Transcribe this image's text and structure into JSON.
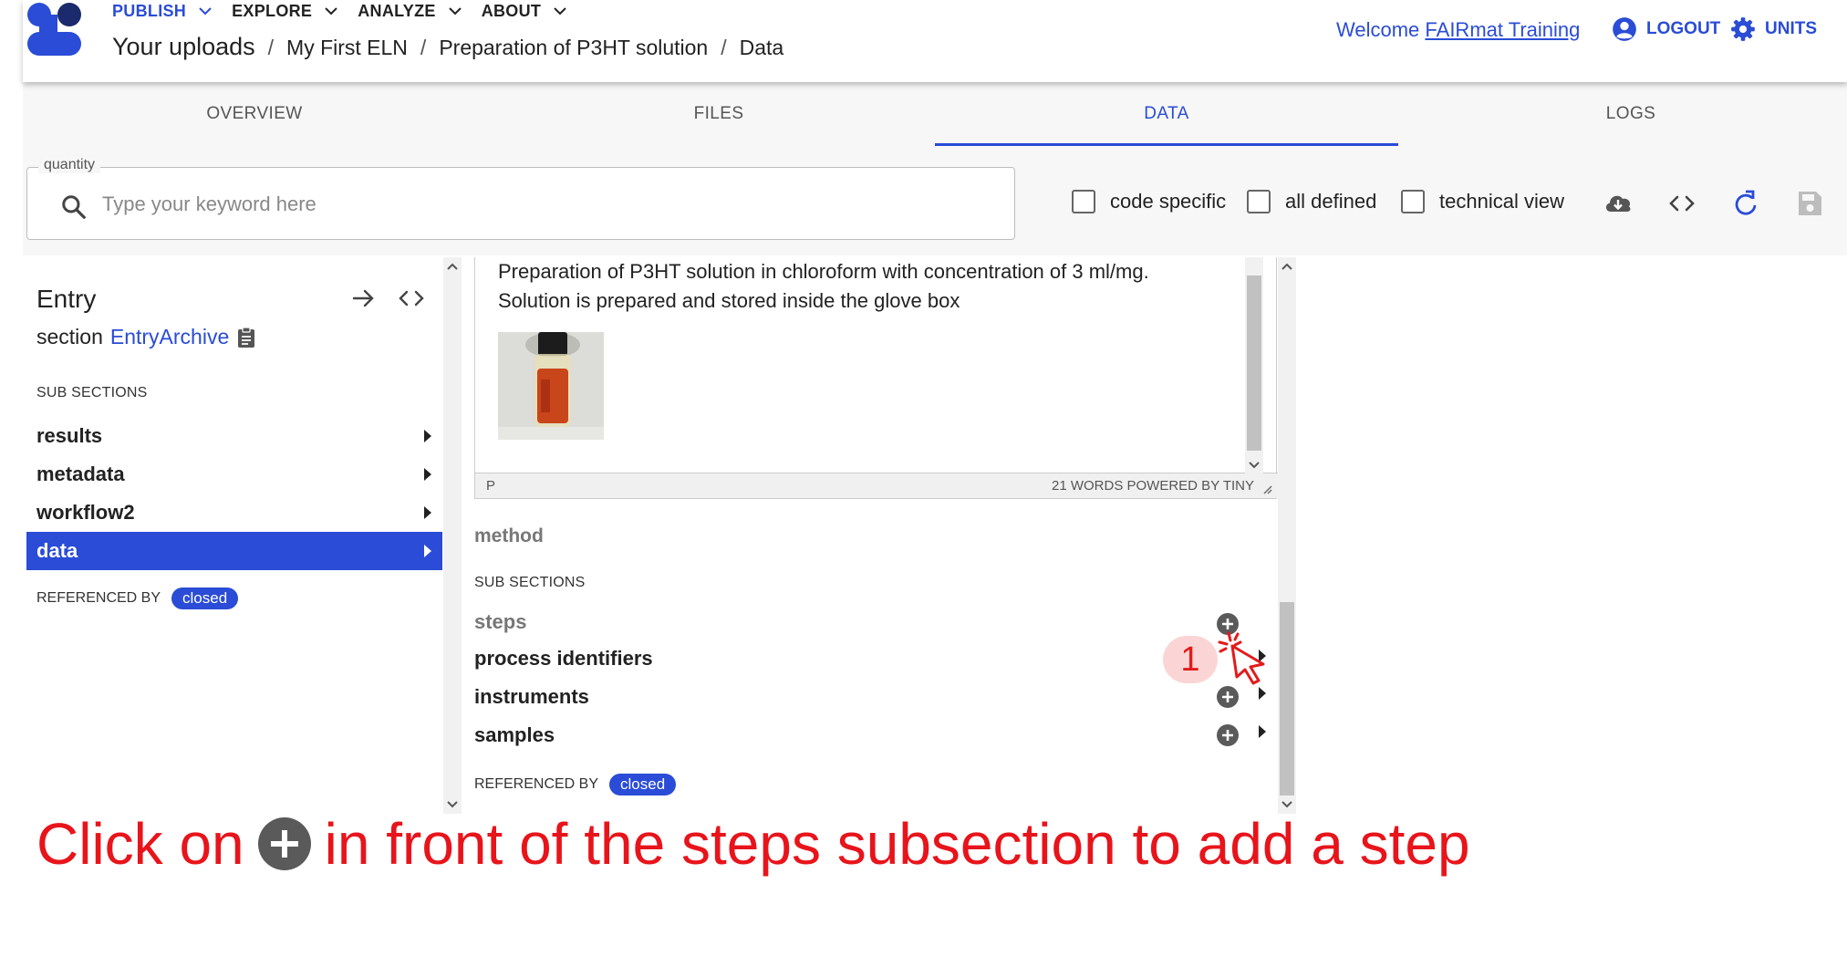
{
  "nav": {
    "menus": [
      {
        "label": "PUBLISH",
        "active": true
      },
      {
        "label": "EXPLORE",
        "active": false
      },
      {
        "label": "ANALYZE",
        "active": false
      },
      {
        "label": "ABOUT",
        "active": false
      }
    ],
    "breadcrumb": [
      "Your uploads",
      "My First ELN",
      "Preparation of P3HT solution",
      "Data"
    ],
    "welcome_prefix": "Welcome",
    "user_name": "FAIRmat Training",
    "logout_label": "LOGOUT",
    "units_label": "UNITS"
  },
  "tabs": [
    "OVERVIEW",
    "FILES",
    "DATA",
    "LOGS"
  ],
  "active_tab": "DATA",
  "toolbar": {
    "search_legend": "quantity",
    "search_placeholder": "Type your keyword here",
    "search_value": "",
    "checkboxes": [
      {
        "label": "code specific",
        "checked": false
      },
      {
        "label": "all defined",
        "checked": false
      },
      {
        "label": "technical view",
        "checked": false
      }
    ]
  },
  "left_panel": {
    "title": "Entry",
    "section_prefix": "section",
    "section_link": "EntryArchive",
    "subsections_heading": "SUB SECTIONS",
    "items": [
      {
        "label": "results",
        "selected": false
      },
      {
        "label": "metadata",
        "selected": false
      },
      {
        "label": "workflow2",
        "selected": false
      },
      {
        "label": "data",
        "selected": true
      }
    ],
    "referenced_by_label": "REFERENCED BY",
    "referenced_by_chip": "closed"
  },
  "middle_panel": {
    "description_line1": "Preparation of P3HT solution in chloroform with concentration of 3 ml/mg.",
    "description_line2": "Solution is prepared and stored inside the glove box",
    "editor_path": "P",
    "editor_status": "21 WORDS  POWERED BY TINY",
    "method_label": "method",
    "subsections_heading": "SUB SECTIONS",
    "items": [
      {
        "label": "steps",
        "muted": true
      },
      {
        "label": "process identifiers",
        "muted": false
      },
      {
        "label": "instruments",
        "muted": false
      },
      {
        "label": "samples",
        "muted": false
      }
    ],
    "referenced_by_label": "REFERENCED BY",
    "referenced_by_chip": "closed"
  },
  "annotation": {
    "step_number": "1",
    "caption_before": "Click on",
    "caption_after": "in front of the steps subsection to add a step"
  },
  "colors": {
    "accent": "#2a4cd6",
    "annotation_red": "#e8141b",
    "muted_text": "#777777"
  }
}
